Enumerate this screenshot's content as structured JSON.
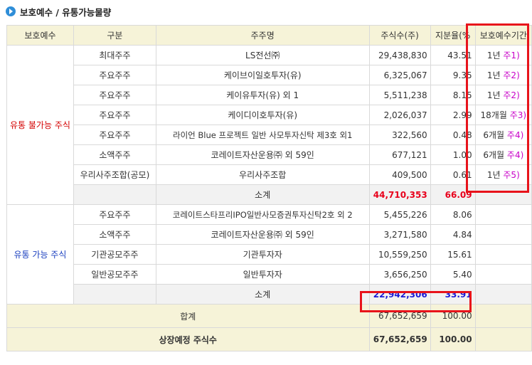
{
  "title": "보호예수 / 유통가능물량",
  "header": {
    "col_group": "보호예수",
    "col_type": "구분",
    "col_holder": "주주명",
    "col_shares": "주식수(주)",
    "col_ratio": "지분율(%",
    "col_period": "보호예수기간"
  },
  "group_locked": {
    "label": "유통 불가능 주식"
  },
  "group_free": {
    "label": "유통 가능 주식"
  },
  "locked_rows": [
    {
      "type": "최대주주",
      "holder": "LS전선㈜",
      "shares": "29,438,830",
      "ratio": "43.51",
      "period": "1년",
      "note": "주1)"
    },
    {
      "type": "주요주주",
      "holder": "케이브이일호투자(유)",
      "shares": "6,325,067",
      "ratio": "9.35",
      "period": "1년",
      "note": "주2)"
    },
    {
      "type": "주요주주",
      "holder": "케이유투자(유) 외 1",
      "shares": "5,511,238",
      "ratio": "8.15",
      "period": "1년",
      "note": "주2)"
    },
    {
      "type": "주요주주",
      "holder": "케이디이호투자(유)",
      "shares": "2,026,037",
      "ratio": "2.99",
      "period": "18개월",
      "note": "주3)"
    },
    {
      "type": "주요주주",
      "holder": "라이언 Blue 프로젝트 일반 사모투자신탁 제3호 외1",
      "shares": "322,560",
      "ratio": "0.48",
      "period": "6개월",
      "note": "주4)"
    },
    {
      "type": "소액주주",
      "holder": "코레이트자산운용㈜ 외 59인",
      "shares": "677,121",
      "ratio": "1.00",
      "period": "6개월",
      "note": "주4)"
    },
    {
      "type": "우리사주조합(공모)",
      "holder": "우리사주조합",
      "shares": "409,500",
      "ratio": "0.61",
      "period": "1년",
      "note": "주5)"
    }
  ],
  "locked_subtotal": {
    "label": "소계",
    "shares": "44,710,353",
    "ratio": "66.09"
  },
  "free_rows": [
    {
      "type": "주요주주",
      "holder": "코레이트스타프리IPO일반사모증권투자신탁2호 외 2",
      "shares": "5,455,226",
      "ratio": "8.06"
    },
    {
      "type": "소액주주",
      "holder": "코레이트자산운용㈜ 외 59인",
      "shares": "3,271,580",
      "ratio": "4.84"
    },
    {
      "type": "기관공모주주",
      "holder": "기관투자자",
      "shares": "10,559,250",
      "ratio": "15.61"
    },
    {
      "type": "일반공모주주",
      "holder": "일반투자자",
      "shares": "3,656,250",
      "ratio": "5.40"
    }
  ],
  "free_subtotal": {
    "label": "소계",
    "shares": "22,942,306",
    "ratio": "33.91"
  },
  "total": {
    "label": "합계",
    "shares": "67,652,659",
    "ratio": "100.00"
  },
  "listing": {
    "label": "상장예정 주식수",
    "shares": "67,652,659",
    "ratio": "100.00"
  },
  "colors": {
    "highlight": "#e8131b",
    "header_bg": "#f6f3d8",
    "note": "#c800c8",
    "locked": "#d40000",
    "free": "#1a3fbf"
  }
}
